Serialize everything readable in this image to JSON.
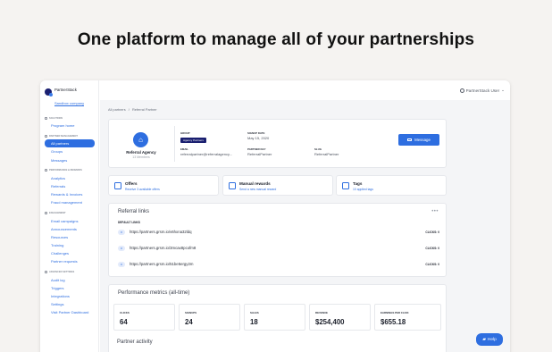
{
  "headline": "One platform to manage all of your partnerships",
  "brand": {
    "name": "PartnerStack",
    "company": "Sandbox company"
  },
  "sidebar": {
    "solutions": {
      "label": "SOLUTIONS",
      "items": [
        "Program home"
      ]
    },
    "partner_management": {
      "label": "PARTNER MANAGEMENT",
      "items": [
        "All partners",
        "Groups",
        "Messages"
      ]
    },
    "performance": {
      "label": "PERFORMANCE & REWARDS",
      "items": [
        "Analytics",
        "Referrals",
        "Rewards & Invoices",
        "Fraud management"
      ]
    },
    "engagement": {
      "label": "ENGAGEMENT",
      "items": [
        "Email campaigns",
        "Announcements",
        "Resources",
        "Training",
        "Challenges",
        "Partner requests"
      ]
    },
    "advanced": {
      "label": "ADVANCED SETTINGS",
      "items": [
        "Audit log",
        "Triggers",
        "Integrations",
        "Settings",
        "Visit Partner Dashboard"
      ]
    }
  },
  "topbar": {
    "user": "PartnerStack User"
  },
  "breadcrumb": {
    "root": "All partners",
    "sep": "/",
    "current": "Referral Partner"
  },
  "profile": {
    "name": "Referral Agency",
    "members": "13 Members",
    "group_label": "GROUP",
    "group_value": "Agency Partners",
    "signup_label": "SIGNUP DATE",
    "signup_value": "May 15, 2020",
    "email_label": "EMAIL",
    "email_value": "referralpartner@referralagency...",
    "key_label": "PARTNER KEY",
    "key_value": "ReferralPartner",
    "slug_label": "SLUG",
    "slug_value": "ReferralPartner",
    "message_btn": "Message"
  },
  "quick": [
    {
      "title": "Offers",
      "sub": "Receive 3 available offers"
    },
    {
      "title": "Manual rewards",
      "sub": "Send a new manual reward"
    },
    {
      "title": "Tags",
      "sub": "10 applied tags"
    }
  ],
  "referral": {
    "title": "Referral links",
    "more": "•••",
    "default_label": "DEFAULT LINKS",
    "links": [
      {
        "url": "https://partners.grsm.io/v6hxna32ldq",
        "clicks": "CLICKS: 0"
      },
      {
        "url": "https://partners.grsm.io/3mcax8pcofm8",
        "clicks": "CLICKS: 0"
      },
      {
        "url": "https://partners.grsm.io/51be5ergy2m",
        "clicks": "CLICKS: 0"
      }
    ]
  },
  "performance": {
    "title": "Performance metrics (all-time)",
    "metrics": [
      {
        "label": "CLICKS",
        "value": "64"
      },
      {
        "label": "SIGNUPS",
        "value": "24"
      },
      {
        "label": "SALES",
        "value": "18"
      },
      {
        "label": "REVENUE",
        "value": "$254,400"
      },
      {
        "label": "EARNINGS PER CLICK",
        "value": "$655.18"
      }
    ]
  },
  "activity": {
    "title": "Partner activity"
  },
  "help": {
    "label": "Help"
  }
}
